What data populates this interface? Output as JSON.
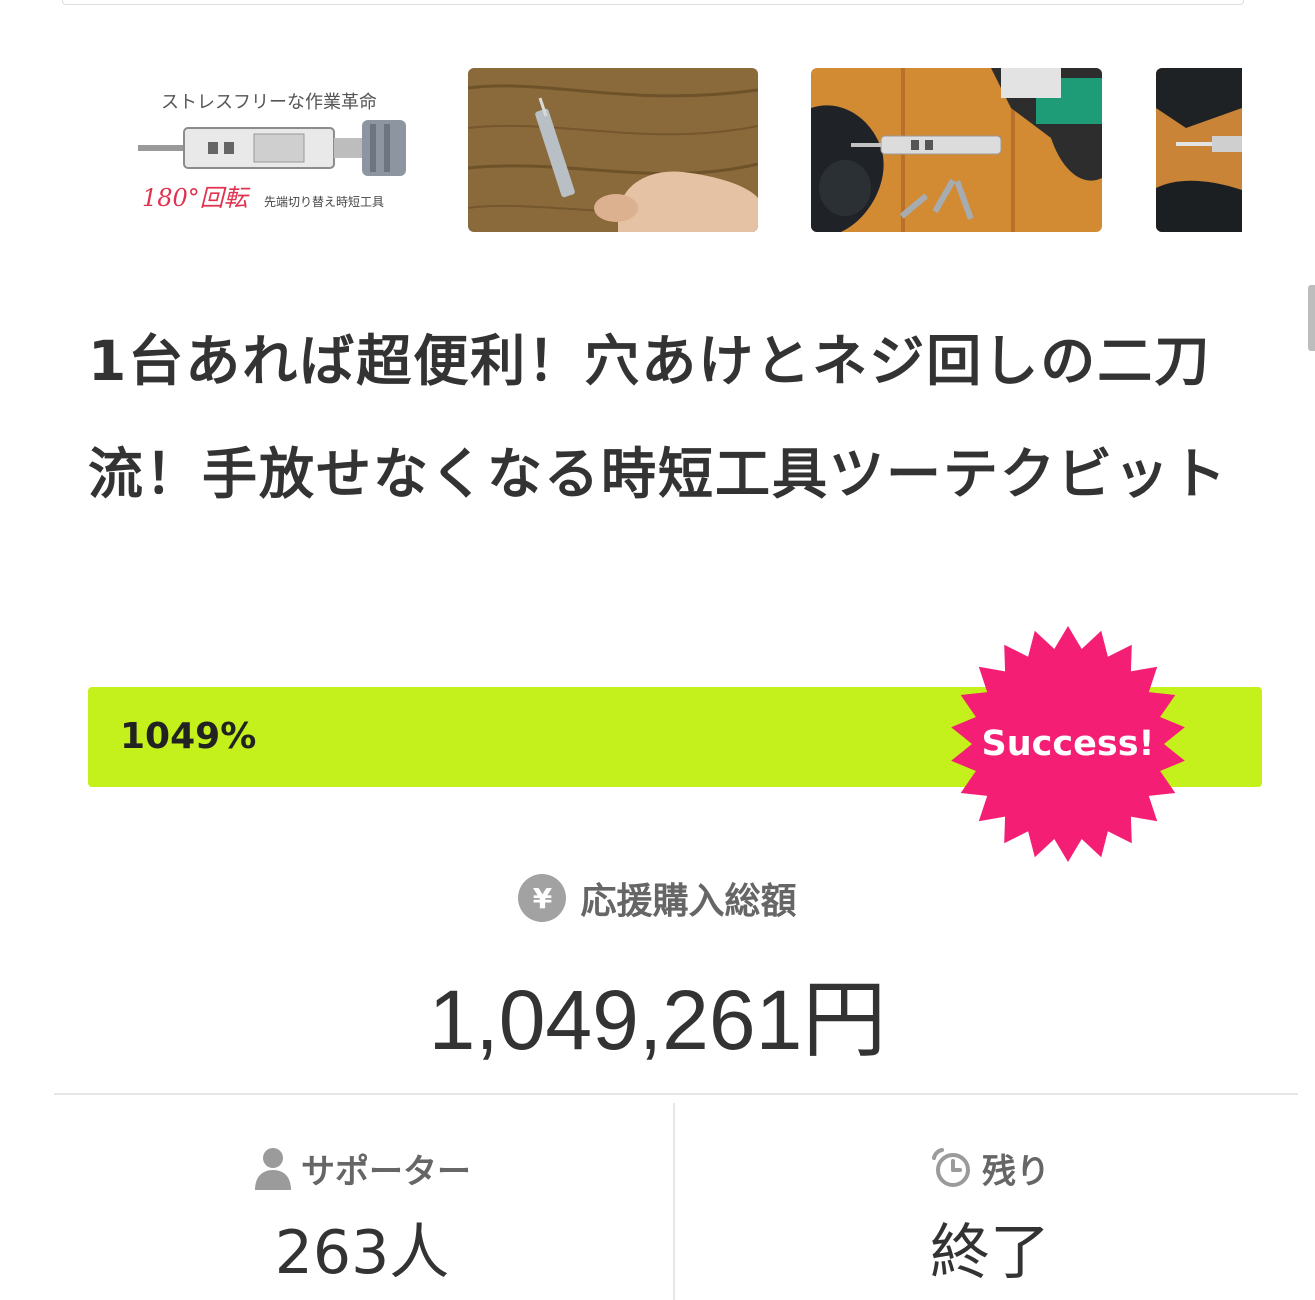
{
  "thumbnails": [
    {
      "name": "thumbnail-1",
      "caption_top": "ストレスフリーな作業革命",
      "caption_angle": "180°回転",
      "caption_sub": "先端切り替え時短工具"
    },
    {
      "name": "thumbnail-2"
    },
    {
      "name": "thumbnail-3"
    },
    {
      "name": "thumbnail-4"
    }
  ],
  "project": {
    "title": "1台あれば超便利！穴あけとネジ回しの二刀流！手放せなくなる時短工具ツーテクビット"
  },
  "progress": {
    "percent_label": "1049%",
    "fill_fraction": 1.0,
    "badge_label": "Success!",
    "colors": {
      "bar": "#c4f01b",
      "badge": "#f41e74"
    }
  },
  "total": {
    "icon": "yen-icon",
    "icon_glyph": "¥",
    "label": "応援購入総額",
    "amount": "1,049,261円"
  },
  "stats": {
    "supporters": {
      "icon": "person-icon",
      "label": "サポーター",
      "value": "263人"
    },
    "remaining": {
      "icon": "timer-icon",
      "label": "残り",
      "value": "終了"
    }
  }
}
